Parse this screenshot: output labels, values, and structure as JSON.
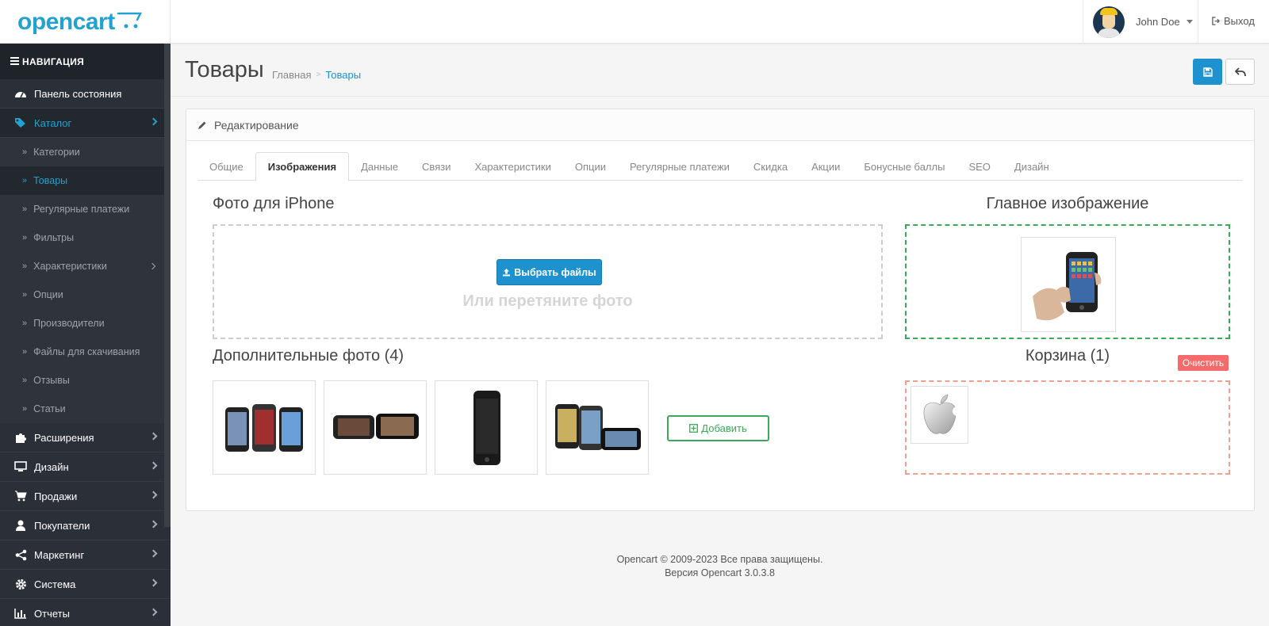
{
  "app": {
    "logo_text": "opencart",
    "accent": "#23a1d1"
  },
  "header": {
    "user_name": "John Doe",
    "logout_label": "Выход"
  },
  "sidebar": {
    "title": "НАВИГАЦИЯ",
    "items": [
      {
        "label": "Панель состояния",
        "icon": "dashboard-icon"
      },
      {
        "label": "Каталог",
        "icon": "tags-icon"
      },
      {
        "label": "Расширения",
        "icon": "puzzle-icon"
      },
      {
        "label": "Дизайн",
        "icon": "monitor-icon"
      },
      {
        "label": "Продажи",
        "icon": "cart-icon"
      },
      {
        "label": "Покупатели",
        "icon": "user-icon"
      },
      {
        "label": "Маркетинг",
        "icon": "share-icon"
      },
      {
        "label": "Система",
        "icon": "gear-icon"
      },
      {
        "label": "Отчеты",
        "icon": "bar-chart-icon"
      }
    ],
    "catalog_sub": [
      {
        "label": "Категории"
      },
      {
        "label": "Товары"
      },
      {
        "label": "Регулярные платежи"
      },
      {
        "label": "Фильтры"
      },
      {
        "label": "Характеристики"
      },
      {
        "label": "Опции"
      },
      {
        "label": "Производители"
      },
      {
        "label": "Файлы для скачивания"
      },
      {
        "label": "Отзывы"
      },
      {
        "label": "Статьи"
      }
    ]
  },
  "page": {
    "title": "Товары",
    "breadcrumb": [
      "Главная",
      "Товары"
    ]
  },
  "panel": {
    "heading": "Редактирование",
    "tabs": [
      "Общие",
      "Изображения",
      "Данные",
      "Связи",
      "Характеристики",
      "Опции",
      "Регулярные платежи",
      "Скидка",
      "Акции",
      "Бонусные баллы",
      "SEO",
      "Дизайн"
    ],
    "active_tab": "Изображения"
  },
  "images": {
    "upload_title": "Фото для iPhone",
    "pick_files_label": "Выбрать файлы",
    "drop_hint": "Или перетяните фото",
    "main_title": "Главное изображение",
    "extra_title": "Дополнительные фото (4)",
    "add_label": "Добавить",
    "cart_title": "Корзина (1)",
    "clear_label": "Очистить"
  },
  "footer": {
    "line1": "Opencart © 2009-2023 Все права защищены.",
    "line2": "Версия Opencart 3.0.3.8"
  }
}
